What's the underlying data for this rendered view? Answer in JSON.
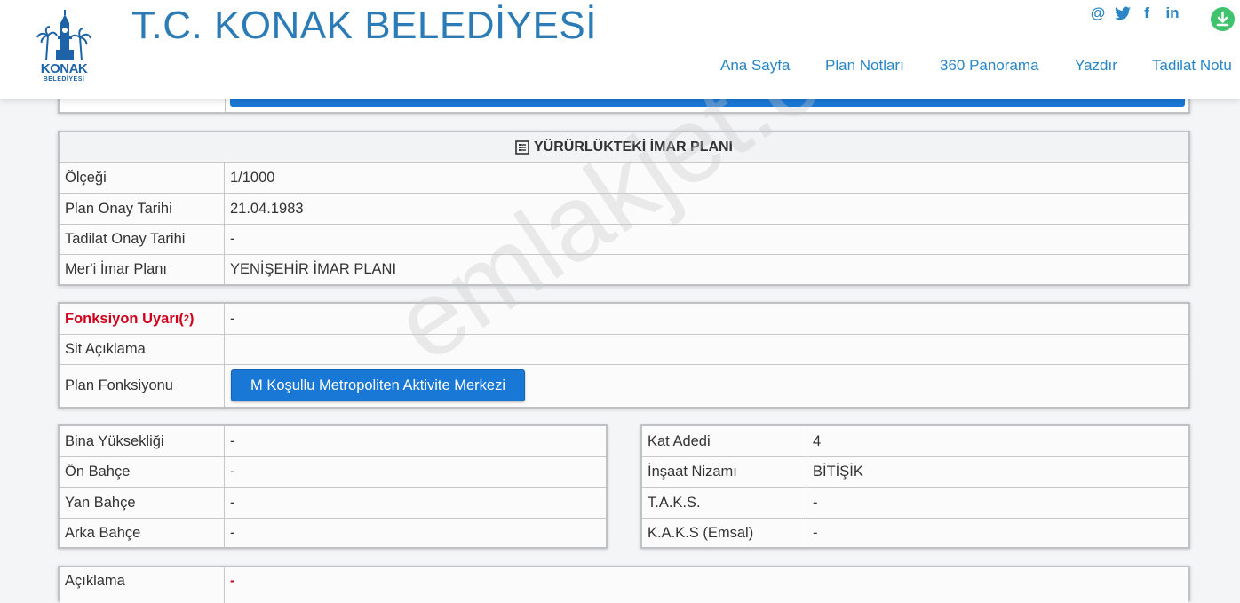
{
  "header": {
    "logo_text": "KONAK",
    "logo_subtext": "BELEDİYESİ",
    "title": "T.C. KONAK BELEDİYESİ",
    "social": {
      "email_glyph": "@",
      "facebook_glyph": "f",
      "linkedin_glyph": "in"
    },
    "nav": [
      "Ana Sayfa",
      "Plan Notları",
      "360 Panorama",
      "Yazdır",
      "Tadilat Notu"
    ]
  },
  "plan_card": {
    "title": "YÜRÜRLÜKTEKİ İMAR PLANI",
    "rows": [
      {
        "label": "Ölçeği",
        "value": "1/1000"
      },
      {
        "label": "Plan Onay Tarihi",
        "value": "21.04.1983"
      },
      {
        "label": "Tadilat Onay Tarihi",
        "value": "-"
      },
      {
        "label": "Mer'i İmar Planı",
        "value": "YENİŞEHİR İMAR PLANI"
      }
    ]
  },
  "function_card": {
    "warning_label": "Fonksiyon Uyarı(",
    "warning_sup": "2",
    "warning_close": ")",
    "warning_value": "-",
    "sit_label": "Sit Açıklama",
    "sit_value": "",
    "plan_function_label": "Plan Fonksiyonu",
    "plan_function_button": "M Koşullu Metropoliten Aktivite Merkezi"
  },
  "left_card": {
    "rows": [
      {
        "label": "Bina Yüksekliği",
        "value": "-"
      },
      {
        "label": "Ön Bahçe",
        "value": "-"
      },
      {
        "label": "Yan Bahçe",
        "value": "-"
      },
      {
        "label": "Arka Bahçe",
        "value": "-"
      }
    ]
  },
  "right_card": {
    "rows": [
      {
        "label": "Kat Adedi",
        "value": "4"
      },
      {
        "label": "İnşaat Nizamı",
        "value": "BİTİŞİK"
      },
      {
        "label": "T.A.K.S.",
        "value": "-"
      },
      {
        "label": "K.A.K.S (Emsal)",
        "value": "-"
      }
    ]
  },
  "notes_card": {
    "label": "Açıklama",
    "value": "-"
  },
  "watermark": "emlakjet.com",
  "colors": {
    "brand_blue": "#2a7bb6",
    "nav_blue": "#2a86c6",
    "button_blue": "#1978d6",
    "warning_red": "#d0021b",
    "download_green": "#3fc36e"
  }
}
